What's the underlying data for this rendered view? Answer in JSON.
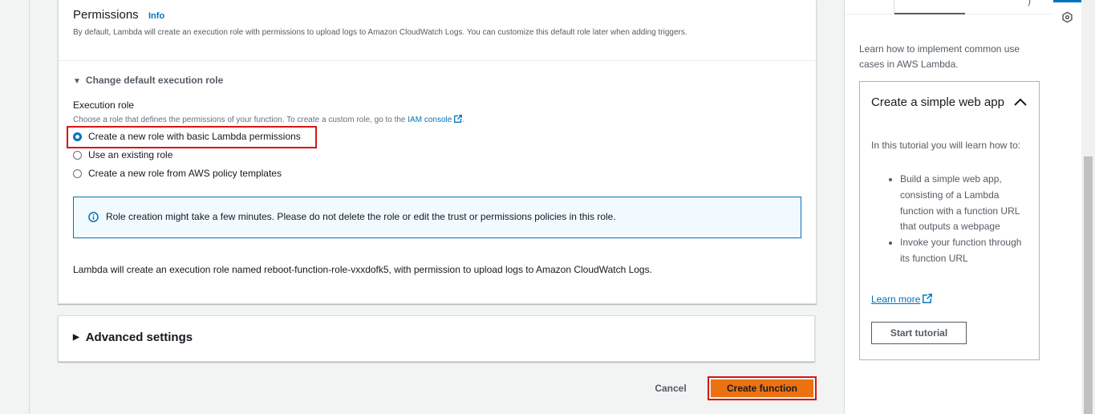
{
  "permissions": {
    "title": "Permissions",
    "info_link": "Info",
    "description": "By default, Lambda will create an execution role with permissions to upload logs to Amazon CloudWatch Logs. You can customize this default role later when adding triggers.",
    "toggle_label": "Change default execution role",
    "execution_role": {
      "label": "Execution role",
      "description": "Choose a role that defines the permissions of your function. To create a custom role, go to the",
      "iam_link": "IAM console",
      "description_end": ".",
      "options": [
        {
          "label": "Create a new role with basic Lambda permissions",
          "selected": true
        },
        {
          "label": "Use an existing role",
          "selected": false
        },
        {
          "label": "Create a new role from AWS policy templates",
          "selected": false
        }
      ]
    },
    "alert_text": "Role creation might take a few minutes. Please do not delete the role or edit the trust or permissions policies in this role.",
    "note": "Lambda will create an execution role named reboot-function-role-vxxdofk5, with permission to upload logs to Amazon CloudWatch Logs."
  },
  "advanced_settings": {
    "label": "Advanced settings"
  },
  "footer": {
    "cancel_label": "Cancel",
    "create_label": "Create function"
  },
  "side_panel": {
    "intro": "Learn how to implement common use cases in AWS Lambda.",
    "tutorial": {
      "title": "Create a simple web app",
      "intro": "In this tutorial you will learn how to:",
      "items": [
        "Build a simple web app, consisting of a Lambda function with a function URL that outputs a webpage",
        "Invoke your function through its function URL"
      ],
      "learn_more": "Learn more",
      "start_label": "Start tutorial"
    }
  },
  "icons": {
    "info": "info-circle-icon",
    "external": "external-link-icon",
    "collapse": "chevron-up-icon",
    "rail": "tutorial-hexagon-icon"
  },
  "colors": {
    "accent": "#0073bb",
    "primary_button": "#ec7211",
    "highlight_border": "#d91515"
  }
}
